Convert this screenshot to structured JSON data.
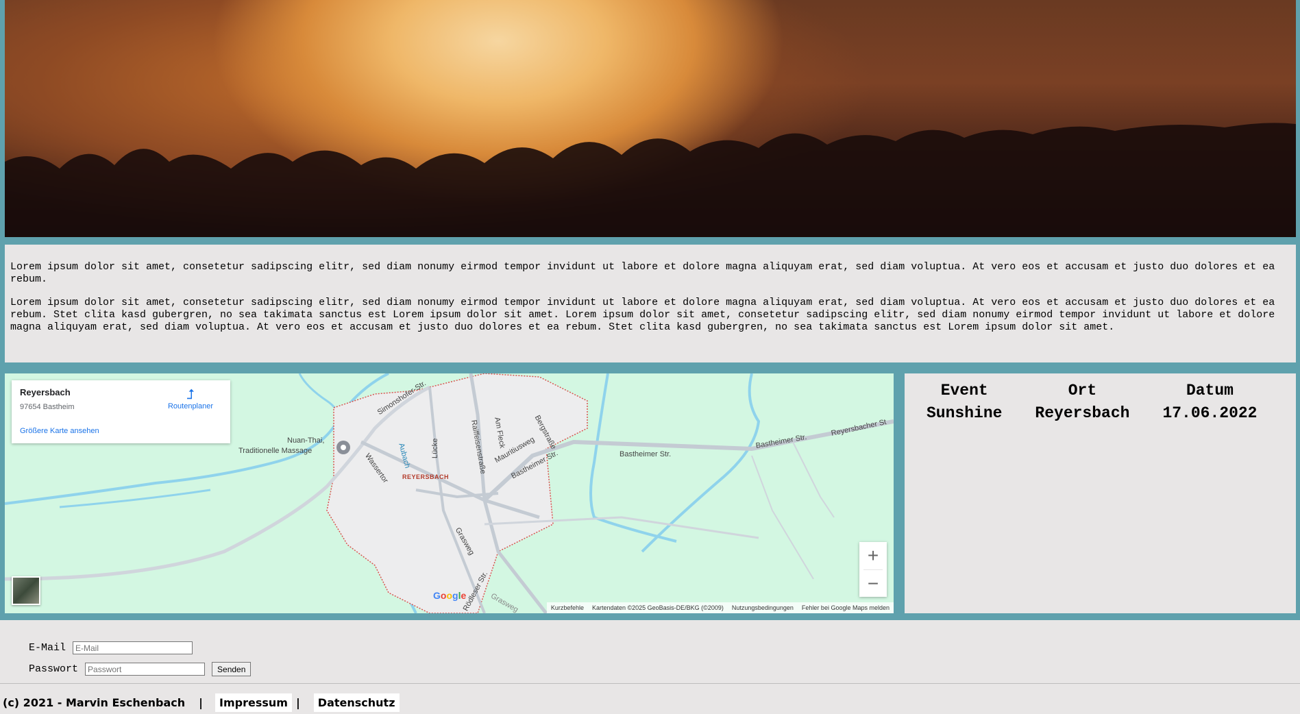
{
  "intro": {
    "paragraph1": "Lorem ipsum dolor sit amet, consetetur sadipscing elitr, sed diam nonumy eirmod tempor invidunt ut labore et dolore magna aliquyam erat, sed diam voluptua. At vero eos et accusam et justo duo dolores et ea rebum.",
    "paragraph2": "Lorem ipsum dolor sit amet, consetetur sadipscing elitr, sed diam nonumy eirmod tempor invidunt ut labore et dolore magna aliquyam erat, sed diam voluptua. At vero eos et accusam et justo duo dolores et ea rebum. Stet clita kasd gubergren, no sea takimata sanctus est Lorem ipsum dolor sit amet. Lorem ipsum dolor sit amet, consetetur sadipscing elitr, sed diam nonumy eirmod tempor invidunt ut labore et dolore magna aliquyam erat, sed diam voluptua. At vero eos et accusam et justo duo dolores et ea rebum. Stet clita kasd gubergren, no sea takimata sanctus est Lorem ipsum dolor sit amet."
  },
  "map": {
    "place_title": "Reyersbach",
    "place_address": "97654 Bastheim",
    "directions_label": "Routenplaner",
    "larger_map_link": "Größere Karte ansehen",
    "poi_label_1": "Nuan-Thai,",
    "poi_label_2": "Traditionelle Massage",
    "town_label": "REYERSBACH",
    "streets": [
      "Simonshofer-Str.",
      "Wassertor",
      "Aubach",
      "Lücke",
      "Raiffeisenstraße",
      "Am Fleck",
      "Mauritiusweg",
      "Bergstraße",
      "Bastheimer Str.",
      "Bastheimer Str.",
      "Bastheimer Str.",
      "Reyersbacher St",
      "Grasweg",
      "Rödleser Str.",
      "Grasweg"
    ],
    "footer": {
      "shortcuts": "Kurzbefehle",
      "map_data": "Kartendaten ©2025 GeoBasis-DE/BKG (©2009)",
      "terms": "Nutzungsbedingungen",
      "report": "Fehler bei Google Maps melden"
    },
    "zoom_in": "+",
    "zoom_out": "−",
    "logo": "Google"
  },
  "event_table": {
    "headers": [
      "Event",
      "Ort",
      "Datum"
    ],
    "row": [
      "Sunshine",
      "Reyersbach",
      "17.06.2022"
    ]
  },
  "login": {
    "email_label": "E-Mail",
    "email_placeholder": "E-Mail",
    "password_label": "Passwort",
    "password_placeholder": "Passwort",
    "submit_label": "Senden"
  },
  "footer": {
    "copyright": "(c) 2021 - Marvin Eschenbach",
    "separator": "|",
    "impressum": "Impressum",
    "datenschutz": "Datenschutz"
  },
  "colors": {
    "frame": "#5fa1ad",
    "panel": "#e8e6e6",
    "map_green": "#d3f7e2",
    "link_blue": "#1a73e8"
  }
}
